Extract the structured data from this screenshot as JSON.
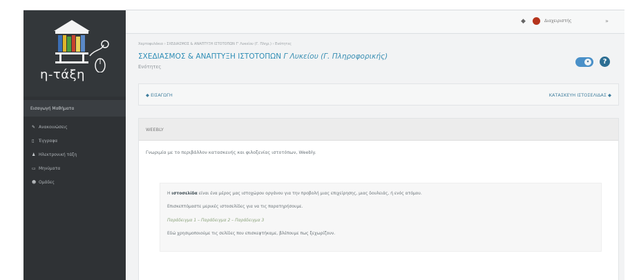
{
  "logo": {
    "text": "η-τάξη"
  },
  "sidebar": {
    "header": "Εισαγωγή Μαθήματα",
    "items": [
      {
        "icon": "bullhorn-icon",
        "glyph": "✎",
        "label": "Ανακοινώσεις"
      },
      {
        "icon": "document-icon",
        "glyph": "▯",
        "label": "Έγγραφα"
      },
      {
        "icon": "users-icon",
        "glyph": "♟",
        "label": "Ηλεκτρονική τάξη"
      },
      {
        "icon": "chat-icon",
        "glyph": "▭",
        "label": "Μηνύματα"
      },
      {
        "icon": "group-icon",
        "glyph": "☻",
        "label": "Ομάδες"
      }
    ]
  },
  "topbar": {
    "bell_glyph": "◆",
    "user": "Διαχειριστής",
    "more_glyph": "»"
  },
  "page": {
    "breadcrumb": "Χαρτοφυλάκιο › ΣΧΕΔΙΑΣΜΟΣ & ΑΝΑΠΤΥΞΗ ΙΣΤΟΤΟΠΩΝ Γ' Λυκείου (Γ. Πληρ.) › Ενότητες",
    "title_main": "ΣΧΕΔΙΑΣΜΟΣ & ΑΝΑΠΤΥΞΗ ΙΣΤΟΤΟΠΩΝ",
    "title_italic": "Γ Λυκείου (Γ. Πληροφορικής)",
    "subtitle": "Ενότητες",
    "toggle_glyph": "▾",
    "help_glyph": "?"
  },
  "unit_nav": {
    "prev": "◆ ΕΙΣΑΓΩΓΗ",
    "next": "ΚΑΤΑΣΚΕΥΗ ΙΣΤΟΣΕΛΙΔΑΣ ◆"
  },
  "unit": {
    "title": "WEEBLY",
    "intro": "Γνωριμία με το περιβάλλον κατασκευής και φιλοξενίας ιστοτόπων, Weebly.",
    "line1_prefix": "Η ",
    "line1_bold": "ιστοσελίδα",
    "line1_rest": " είναι ένα μέρος μας ιστοχώρου οργάνου για την προβολή μιας επιχείρησης, μιας δουλειάς, ή ενός ατόμου.",
    "line2": "Επισκεπτόμαστε μερικές ιστοσελίδες για να τις παρατηρήσουμε.",
    "line3": "Παράδειγμα 1 – Παράδειγμα 2 – Παράδειγμα 3",
    "line4": "Εδώ χρησιμοποιούμε τις σελίδες που επισκεφτήκαμε, βλέπουμε πως ξεχωρίζουν."
  }
}
